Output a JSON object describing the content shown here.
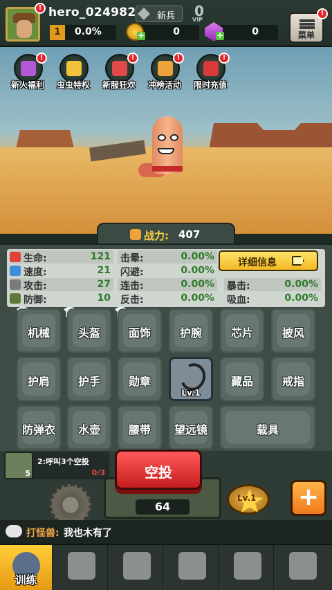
{
  "player": {
    "name": "hero_024982",
    "rank": "新兵",
    "vip_level": "0",
    "vip_label": "VIP",
    "level": "1",
    "exp_percent": "0.0%"
  },
  "resources": {
    "coins": "0",
    "gems": "0"
  },
  "menu": {
    "label": "菜单"
  },
  "buffs": [
    {
      "label": "新人福利",
      "color": "#b45ad8"
    },
    {
      "label": "虫虫特权",
      "color": "#f2c23a"
    },
    {
      "label": "新服狂欢",
      "color": "#e24a4a"
    },
    {
      "label": "冲榜活动",
      "color": "#f0a23a"
    },
    {
      "label": "限时充值",
      "color": "#d83a3a"
    }
  ],
  "power": {
    "label": "战力:",
    "value": "407"
  },
  "stats": {
    "hp": {
      "label": "生命:",
      "value": "121"
    },
    "speed": {
      "label": "速度:",
      "value": "21"
    },
    "attack": {
      "label": "攻击:",
      "value": "27"
    },
    "defense": {
      "label": "防御:",
      "value": "10"
    },
    "stun": {
      "label": "击晕:",
      "value": "0.00%"
    },
    "dodge": {
      "label": "闪避:",
      "value": "0.00%"
    },
    "combo": {
      "label": "连击:",
      "value": "0.00%"
    },
    "counter": {
      "label": "反击:",
      "value": "0.00%"
    },
    "crit": {
      "label": "暴击:",
      "value": "0.00%"
    },
    "lifesteal": {
      "label": "吸血:",
      "value": "0.00%"
    }
  },
  "detail_button": "详细信息",
  "slots": {
    "machinery": "机械",
    "helmet": "头盔",
    "mask": "面饰",
    "wrist": "护腕",
    "chip": "芯片",
    "cape": "披风",
    "shoulder": "护肩",
    "gloves": "护手",
    "medal": "勋章",
    "equipped_level": "Lv.1",
    "collection": "藏品",
    "ring": "戒指",
    "vest": "防弹衣",
    "kettle": "水壶",
    "belt": "腰带",
    "telescope": "望远镜",
    "vehicle": "载具"
  },
  "task": {
    "text": "2:呼叫3个空投",
    "progress": "0/3",
    "count": "5"
  },
  "airdrop": {
    "label": "空投",
    "count": "64"
  },
  "upgrade": {
    "level": "Lv.1"
  },
  "add_label": "+",
  "chat": {
    "sender": "打怪兽:",
    "message": "我也木有了"
  },
  "nav": {
    "train": "训练"
  }
}
